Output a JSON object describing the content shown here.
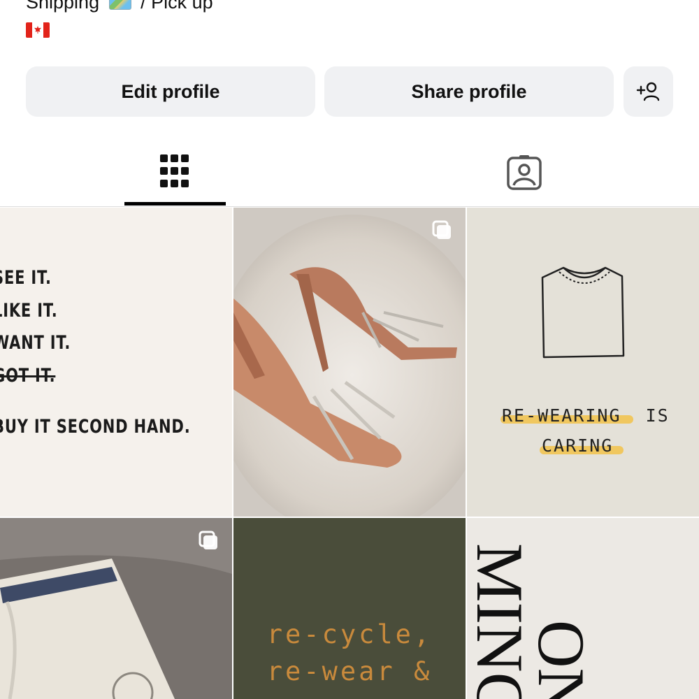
{
  "bio": {
    "line1_prefix": "Shipping",
    "line1_suffix": "/ Pick up",
    "map_emoji": "world-map-icon",
    "flag_emoji": "canada-flag-icon"
  },
  "actions": {
    "edit_label": "Edit profile",
    "share_label": "Share profile",
    "add_person_icon": "add-person-icon"
  },
  "tabs": [
    {
      "name": "posts-grid",
      "icon": "grid-icon",
      "selected": true
    },
    {
      "name": "tagged",
      "icon": "tagged-person-icon",
      "selected": false
    }
  ],
  "posts": [
    {
      "kind": "text-quote",
      "lines": [
        "SEE IT.",
        "LIKE IT.",
        "WANT IT.",
        "GOT IT.",
        "BUY IT SECOND HAND."
      ],
      "multi": false
    },
    {
      "kind": "photo",
      "subject": "nude strappy heels on faux fur",
      "multi": true
    },
    {
      "kind": "illustration",
      "line1a": "RE-WEARING",
      "line1b": "IS",
      "line2": "CARING",
      "multi": false
    },
    {
      "kind": "photo",
      "subject": "cream sweatpants",
      "multi": true
    },
    {
      "kind": "text",
      "line1": "re-cycle,",
      "line2": "re-wear &",
      "multi": false
    },
    {
      "kind": "text",
      "col1": "MING",
      "col2": "ON",
      "multi": false
    }
  ],
  "colors": {
    "button_bg": "#f0f1f3",
    "selected_underline": "#000000",
    "highlighter": "#f2c24a",
    "olive_bg": "#4a4d3a",
    "rust_text": "#c98a3c"
  }
}
